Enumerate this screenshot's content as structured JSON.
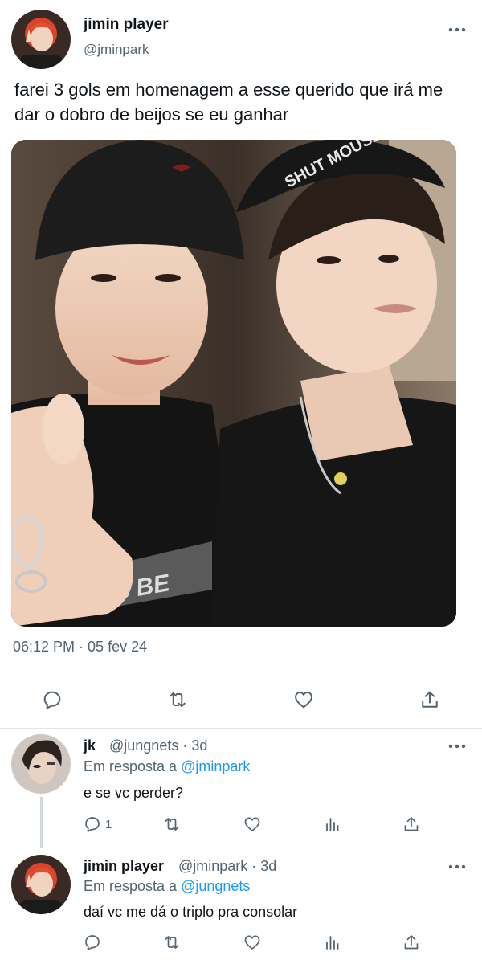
{
  "main_tweet": {
    "display_name": "jimin player",
    "handle": "@jminpark",
    "text": "farei 3 gols em homenagem a esse querido que irá me dar o dobro de beijos se eu ganhar",
    "timestamp": "06:12 PM · 05 fev 24",
    "photo": {
      "beanie_left_text": "",
      "beanie_right_text": "SHUT MOUSE",
      "shirt_text": "BTS BE"
    },
    "actions": [
      "reply-icon",
      "retweet-icon",
      "like-icon",
      "share-icon"
    ]
  },
  "replies": [
    {
      "display_name": "jk",
      "handle": "@jungnets",
      "age": "3d",
      "replying_prefix": "Em resposta a",
      "replying_to": "@jminpark",
      "text": "e se vc perder?",
      "reply_count": "1"
    },
    {
      "display_name": "jimin player",
      "handle": "@jminpark",
      "age": "3d",
      "replying_prefix": "Em resposta a",
      "replying_to": "@jungnets",
      "text": "daí vc me dá o triplo pra consolar",
      "reply_count": ""
    }
  ],
  "colors": {
    "text": "#0f1419",
    "secondary": "#536471",
    "link": "#1d9bf0",
    "divider": "#e1e6ea"
  }
}
